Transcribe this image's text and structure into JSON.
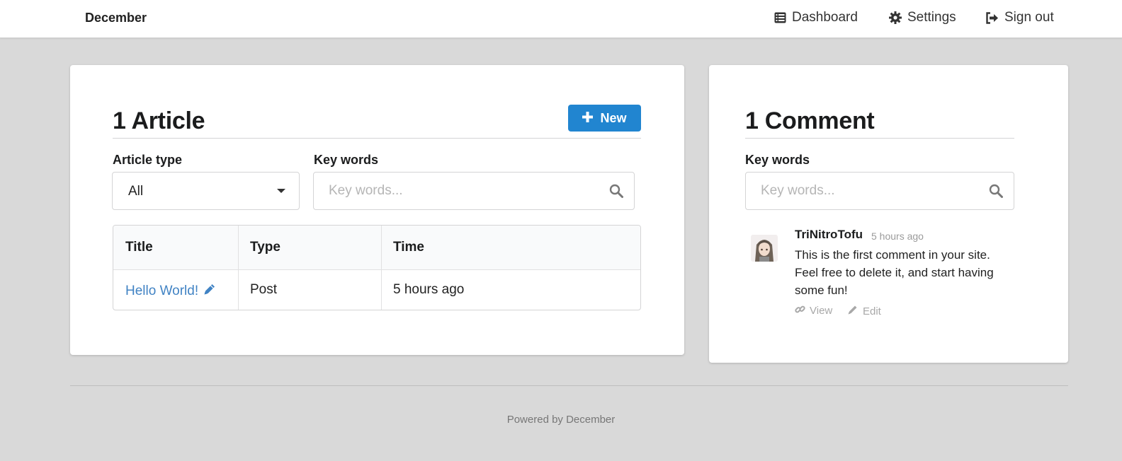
{
  "topbar": {
    "brand": "December",
    "nav": [
      {
        "label": "Dashboard",
        "icon": "list-icon"
      },
      {
        "label": "Settings",
        "icon": "gear-icon"
      },
      {
        "label": "Sign out",
        "icon": "sign-out-icon"
      }
    ]
  },
  "articles": {
    "heading": "1 Article",
    "new_button": "New",
    "type_label": "Article type",
    "type_selected": "All",
    "keywords_label": "Key words",
    "keywords_placeholder": "Key words...",
    "columns": [
      "Title",
      "Type",
      "Time"
    ],
    "rows": [
      {
        "title": "Hello World!",
        "type": "Post",
        "time": "5 hours ago"
      }
    ]
  },
  "comments": {
    "heading": "1 Comment",
    "keywords_label": "Key words",
    "keywords_placeholder": "Key words...",
    "items": [
      {
        "author": "TriNitroTofu",
        "time": "5 hours ago",
        "text": "This is the first comment in your site. Feel free to delete it, and start having some fun!",
        "view_label": "View",
        "edit_label": "Edit"
      }
    ]
  },
  "footer": {
    "text": "Powered by December"
  },
  "colors": {
    "primary": "#2185d0",
    "link": "#4183c4",
    "background": "#d9d9d9"
  }
}
